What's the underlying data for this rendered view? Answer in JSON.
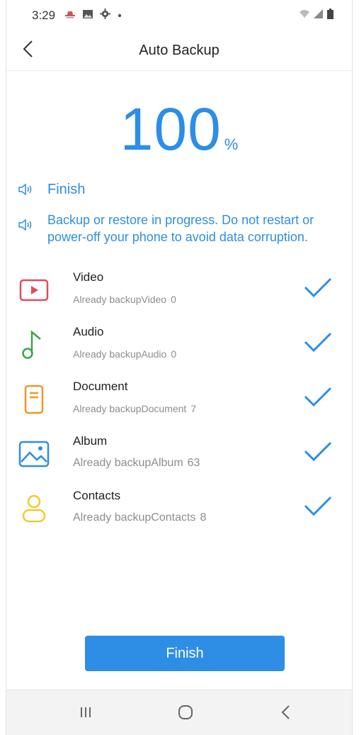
{
  "status_bar": {
    "time": "3:29",
    "left_icons": [
      "hat-icon",
      "image-icon",
      "gear-icon",
      "dot-icon"
    ],
    "right_icons": [
      "wifi-icon",
      "signal-icon",
      "battery-icon"
    ]
  },
  "header": {
    "title": "Auto Backup",
    "back_icon": "chevron-left-icon"
  },
  "progress": {
    "value": "100",
    "unit": "%"
  },
  "notices": {
    "finish": "Finish",
    "warning": "Backup or restore in progress. Do not restart or power-off your phone to avoid data corruption."
  },
  "items": [
    {
      "name": "Video",
      "status": "Already backupVideo",
      "count": "0",
      "icon": "video-icon",
      "color": "#e24b5a"
    },
    {
      "name": "Audio",
      "status": "Already backupAudio",
      "count": "0",
      "icon": "music-note-icon",
      "color": "#3aa548"
    },
    {
      "name": "Document",
      "status": "Already backupDocument",
      "count": "7",
      "icon": "document-icon",
      "color": "#f0962a"
    },
    {
      "name": "Album",
      "status": "Already backupAlbum",
      "count": "63",
      "icon": "album-icon",
      "color": "#2b8ee8"
    },
    {
      "name": "Contacts",
      "status": "Already backupContacts",
      "count": "8",
      "icon": "contacts-icon",
      "color": "#f1cb2e"
    }
  ],
  "finish_button": "Finish",
  "nav_bar": {
    "icons": [
      "recents-icon",
      "home-icon",
      "back-icon"
    ]
  },
  "colors": {
    "accent": "#2e8ee6",
    "check": "#2b8ee8",
    "subtext": "#8d8d8d"
  }
}
